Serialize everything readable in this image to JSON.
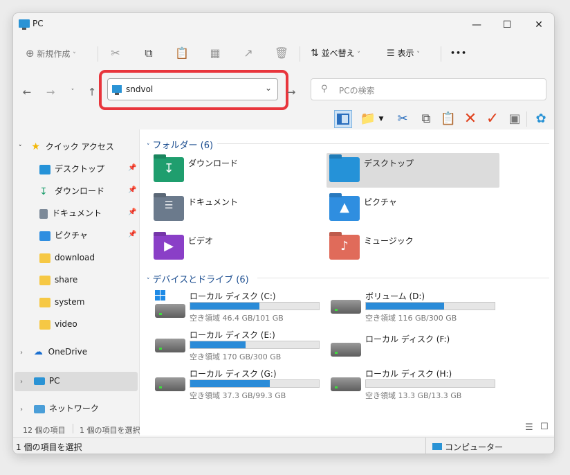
{
  "window": {
    "title": "PC"
  },
  "commandbar": {
    "new_label": "新規作成",
    "sort_label": "並べ替え",
    "view_label": "表示",
    "more": "•••"
  },
  "address": {
    "value": "sndvol"
  },
  "search": {
    "placeholder": "PCの検索"
  },
  "sidebar": {
    "quick_access": "クイック アクセス",
    "items": [
      {
        "label": "デスクトップ",
        "icon": "desktop-icon",
        "pinned": true
      },
      {
        "label": "ダウンロード",
        "icon": "download-icon",
        "pinned": true
      },
      {
        "label": "ドキュメント",
        "icon": "document-icon",
        "pinned": true
      },
      {
        "label": "ピクチャ",
        "icon": "picture-icon",
        "pinned": true
      },
      {
        "label": "download",
        "icon": "folder-icon",
        "pinned": false
      },
      {
        "label": "share",
        "icon": "folder-icon",
        "pinned": false
      },
      {
        "label": "system",
        "icon": "folder-icon",
        "pinned": false
      },
      {
        "label": "video",
        "icon": "folder-icon",
        "pinned": false
      }
    ],
    "onedrive": "OneDrive",
    "pc": "PC",
    "network": "ネットワーク"
  },
  "folders": {
    "header": "フォルダー (6)",
    "items": [
      {
        "name": "ダウンロード",
        "color": "#1f9e6e"
      },
      {
        "name": "デスクトップ",
        "color": "#2592d8"
      },
      {
        "name": "ドキュメント",
        "color": "#6b7a8c"
      },
      {
        "name": "ピクチャ",
        "color": "#2f8ee0"
      },
      {
        "name": "ビデオ",
        "color": "#8a3fc7"
      },
      {
        "name": "ミュージック",
        "color": "#e06b5a"
      }
    ]
  },
  "drives": {
    "header": "デバイスとドライブ (6)",
    "items": [
      {
        "name": "ローカル ディスク (C:)",
        "free": "空き領域 46.4 GB/101 GB",
        "used": 0.54
      },
      {
        "name": "ボリューム (D:)",
        "free": "空き領域 116 GB/300 GB",
        "used": 0.61
      },
      {
        "name": "ローカル ディスク (E:)",
        "free": "空き領域 170 GB/300 GB",
        "used": 0.43
      },
      {
        "name": "ローカル ディスク (F:)",
        "free": "",
        "used": 0
      },
      {
        "name": "ローカル ディスク (G:)",
        "free": "空き領域 37.3 GB/99.3 GB",
        "used": 0.62
      },
      {
        "name": "ローカル ディスク (H:)",
        "free": "空き領域 13.3 GB/13.3 GB",
        "used": 0.0
      }
    ]
  },
  "status": {
    "item_count": "12 個の項目",
    "selected_count": "1 個の項目を選択",
    "bottom_left": "1 個の項目を選択",
    "bottom_right": "コンピューター"
  },
  "colors": {
    "accent": "#2a8bd8",
    "highlight": "#e8353c",
    "link": "#1a4c8f"
  }
}
